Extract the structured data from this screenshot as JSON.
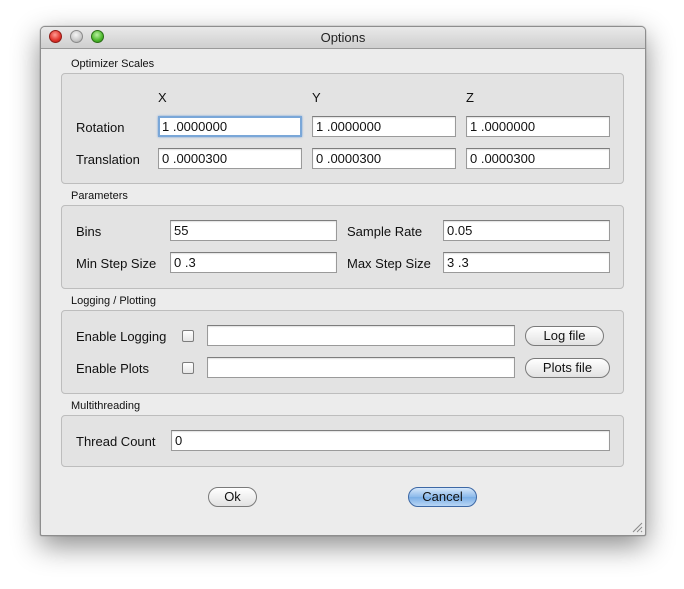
{
  "window": {
    "title": "Options"
  },
  "optimizer_scales": {
    "section_label": "Optimizer Scales",
    "column_headers": [
      "X",
      "Y",
      "Z"
    ],
    "rows": [
      {
        "label": "Rotation",
        "x": "1 .0000000",
        "y": "1 .0000000",
        "z": "1 .0000000"
      },
      {
        "label": "Translation",
        "x": "0 .0000300",
        "y": "0 .0000300",
        "z": "0 .0000300"
      }
    ]
  },
  "parameters": {
    "section_label": "Parameters",
    "bins_label": "Bins",
    "bins_value": "55",
    "sample_rate_label": "Sample Rate",
    "sample_rate_value": "0.05",
    "min_step_label": "Min Step Size",
    "min_step_value": "0 .3",
    "max_step_label": "Max Step Size",
    "max_step_value": "3 .3"
  },
  "logging": {
    "section_label": "Logging / Plotting",
    "enable_logging_label": "Enable Logging",
    "enable_logging_checked": false,
    "log_path_value": "",
    "log_file_button": "Log file",
    "enable_plots_label": "Enable Plots",
    "enable_plots_checked": false,
    "plots_path_value": "",
    "plots_file_button": "Plots file"
  },
  "multithreading": {
    "section_label": "Multithreading",
    "thread_count_label": "Thread Count",
    "thread_count_value": "0"
  },
  "buttons": {
    "ok_label": "Ok",
    "cancel_label": "Cancel"
  },
  "colors": {
    "window_bg": "#ececec",
    "group_bg": "#e3e3e3",
    "focus_ring": "#7aa7d8",
    "default_button": "#8cb9ea"
  }
}
